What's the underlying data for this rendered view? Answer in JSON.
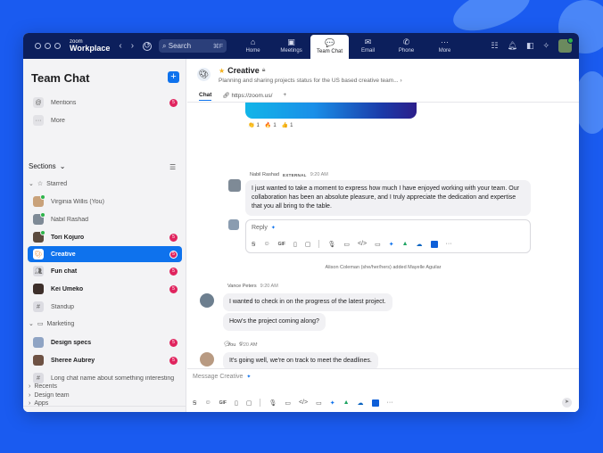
{
  "topbar": {
    "brand_small": "zoom",
    "brand_big": "Workplace",
    "search_placeholder": "Search",
    "search_shortcut": "⌘F",
    "tabs": [
      {
        "label": "Home",
        "icon": "⌂"
      },
      {
        "label": "Meetings",
        "icon": "▣"
      },
      {
        "label": "Team Chat",
        "icon": "💬"
      },
      {
        "label": "Email",
        "icon": "✉"
      },
      {
        "label": "Phone",
        "icon": "✆"
      },
      {
        "label": "More",
        "icon": "···"
      }
    ]
  },
  "sidebar": {
    "title": "Team Chat",
    "mentions": "Mentions",
    "mentions_badge": "5",
    "more": "More",
    "sections_label": "Sections",
    "starred_label": "Starred",
    "starred": [
      {
        "label": "Virginia Willis (You)",
        "badge": ""
      },
      {
        "label": "Nabil Rashad",
        "badge": ""
      },
      {
        "label": "Tori Kojuro",
        "badge": "5"
      },
      {
        "label": "Creative",
        "badge": "5"
      },
      {
        "label": "Fun chat",
        "badge": "5"
      },
      {
        "label": "Kei Umeko",
        "badge": "5"
      },
      {
        "label": "Standup",
        "badge": ""
      }
    ],
    "marketing_label": "Marketing",
    "marketing": [
      {
        "label": "Design specs",
        "badge": "5"
      },
      {
        "label": "Sheree Aubrey",
        "badge": "5"
      },
      {
        "label": "Long chat name about something interesting",
        "badge": ""
      }
    ],
    "design_team": "Design team",
    "recents": "Recents",
    "apps": "Apps"
  },
  "channel": {
    "name": "Creative",
    "description": "Planning and sharing projects status for the US based creative team...",
    "tab_chat": "Chat",
    "tab_link": "https://zoom.us/"
  },
  "reactions": [
    {
      "emoji": "👏",
      "count": "1"
    },
    {
      "emoji": "🔥",
      "count": "1"
    },
    {
      "emoji": "👍",
      "count": "1"
    }
  ],
  "messages": {
    "m1_author": "Nabil Rashad",
    "m1_tag": "EXTERNAL",
    "m1_time": "9:20 AM",
    "m1_text": "I just wanted to take a moment to express how much I have enjoyed working with your team. Our collaboration has been an absolute pleasure, and I truly appreciate the dedication and expertise that you all bring to the table.",
    "reply_label": "Reply",
    "system_line": "Alison Coleman (she/her/hers) added Mayelle Aguilar",
    "m2_author": "Vance Peters",
    "m2_time": "9:20 AM",
    "m2_text1": "I wanted to check in on the progress of the latest project.",
    "m2_text2": "How's the project coming along?",
    "m3_author": "You",
    "m3_time": "9:20 AM",
    "m3_text": "It's going well, we're on track to meet the deadlines."
  },
  "composer": {
    "placeholder": "Message Creative"
  },
  "colors": {
    "accent": "#0e72ed",
    "topbar": "#0c1f5c",
    "background": "#1a5bf0",
    "badge": "#e0245e"
  }
}
